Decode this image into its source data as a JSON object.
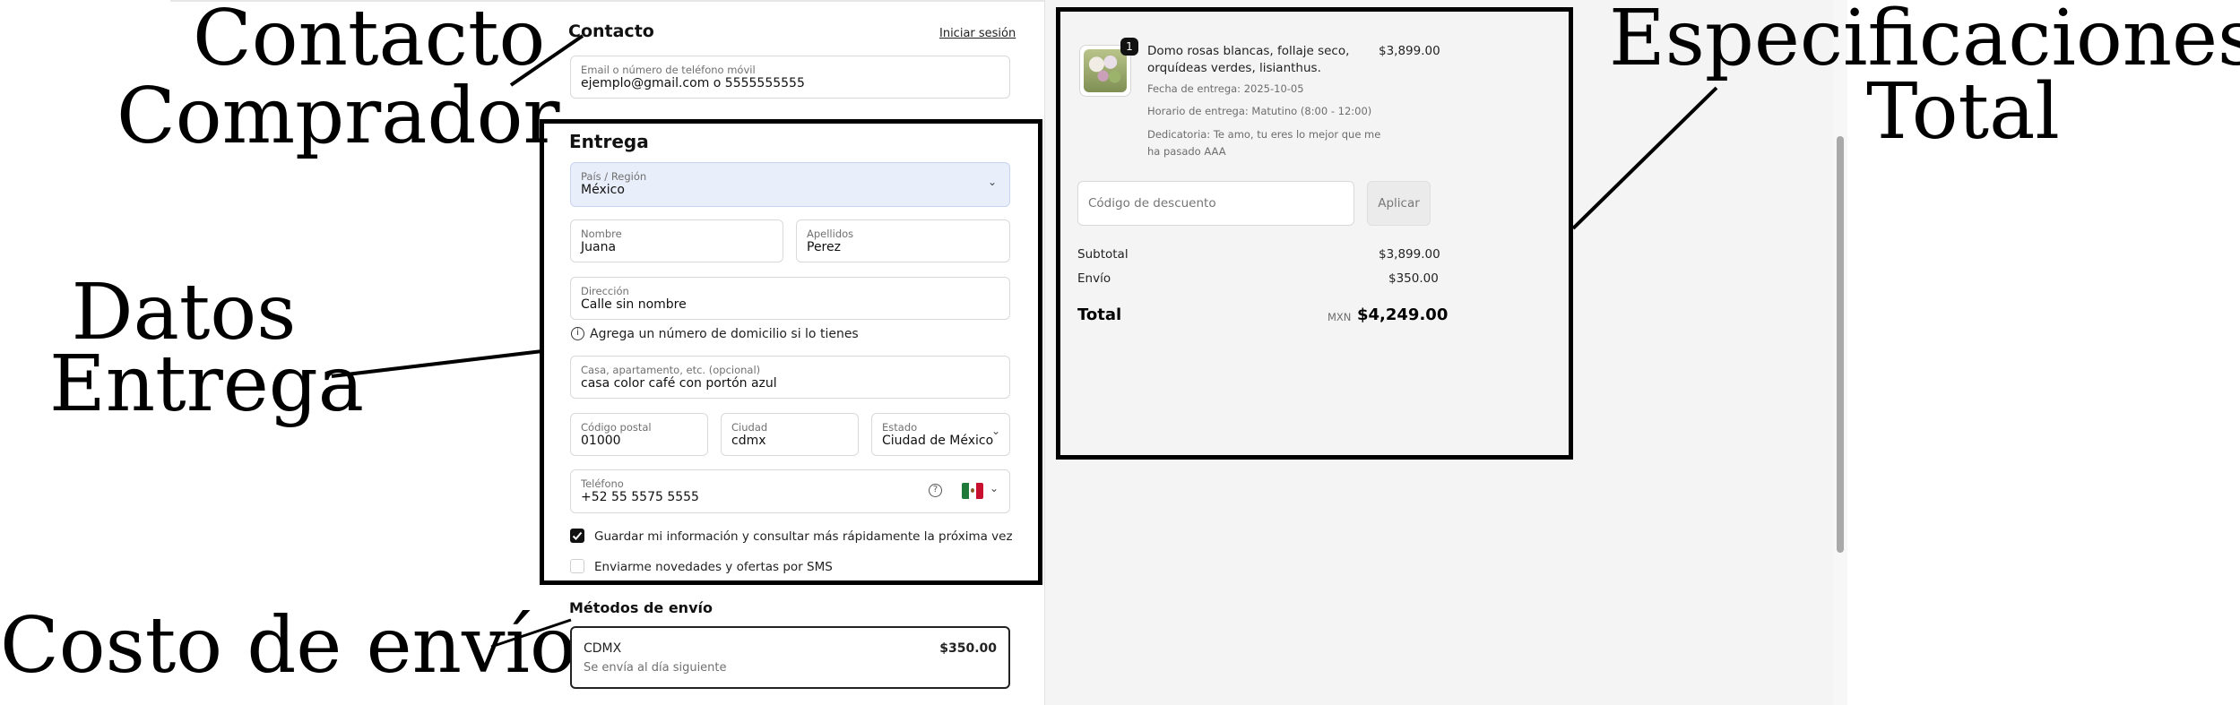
{
  "annotations": {
    "contacto": [
      "Contacto",
      "Comprador"
    ],
    "datos": [
      "Datos",
      "Entrega"
    ],
    "costo": "Costo de envío",
    "especificaciones": [
      "Especificaciones  y",
      "Total"
    ]
  },
  "contact": {
    "title": "Contacto",
    "login_link": "Iniciar sesión",
    "email_label": "Email o número de teléfono móvil",
    "email_value": "ejemplo@gmail.com o 5555555555"
  },
  "delivery": {
    "title": "Entrega",
    "country_label": "País / Región",
    "country_value": "México",
    "first_name_label": "Nombre",
    "first_name_value": "Juana",
    "last_name_label": "Apellidos",
    "last_name_value": "Perez",
    "address_label": "Dirección",
    "address_value": "Calle sin nombre",
    "address_hint": "Agrega un número de domicilio si lo tienes",
    "apt_label": "Casa, apartamento, etc. (opcional)",
    "apt_value": "casa color café con portón azul",
    "postal_label": "Código postal",
    "postal_value": "01000",
    "city_label": "Ciudad",
    "city_value": "cdmx",
    "state_label": "Estado",
    "state_value": "Ciudad de México",
    "phone_label": "Teléfono",
    "phone_value": "+52 55 5575 5555",
    "save_info_label": "Guardar mi información y consultar más rápidamente la próxima vez",
    "save_info_checked": true,
    "sms_label": "Enviarme novedades y ofertas por SMS",
    "sms_checked": false
  },
  "shipping": {
    "title": "Métodos de envío",
    "option_name": "CDMX",
    "option_desc": "Se envía al día siguiente",
    "option_price": "$350.00"
  },
  "summary": {
    "item": {
      "quantity": "1",
      "name_line1": "Domo rosas blancas, follaje seco,",
      "name_line2": "orquídeas verdes, lisianthus.",
      "price": "$3,899.00",
      "delivery_date": "Fecha de entrega: 2025-10-05",
      "delivery_time": "Horario de entrega: Matutino (8:00 - 12:00)",
      "dedication_line1": "Dedicatoria: Te amo, tu eres lo mejor que me",
      "dedication_line2": "ha pasado AAA"
    },
    "discount_placeholder": "Código de descuento",
    "apply_label": "Aplicar",
    "subtotal_label": "Subtotal",
    "subtotal_value": "$3,899.00",
    "shipping_label": "Envío",
    "shipping_value": "$350.00",
    "total_label": "Total",
    "currency": "MXN",
    "total_value": "$4,249.00"
  }
}
